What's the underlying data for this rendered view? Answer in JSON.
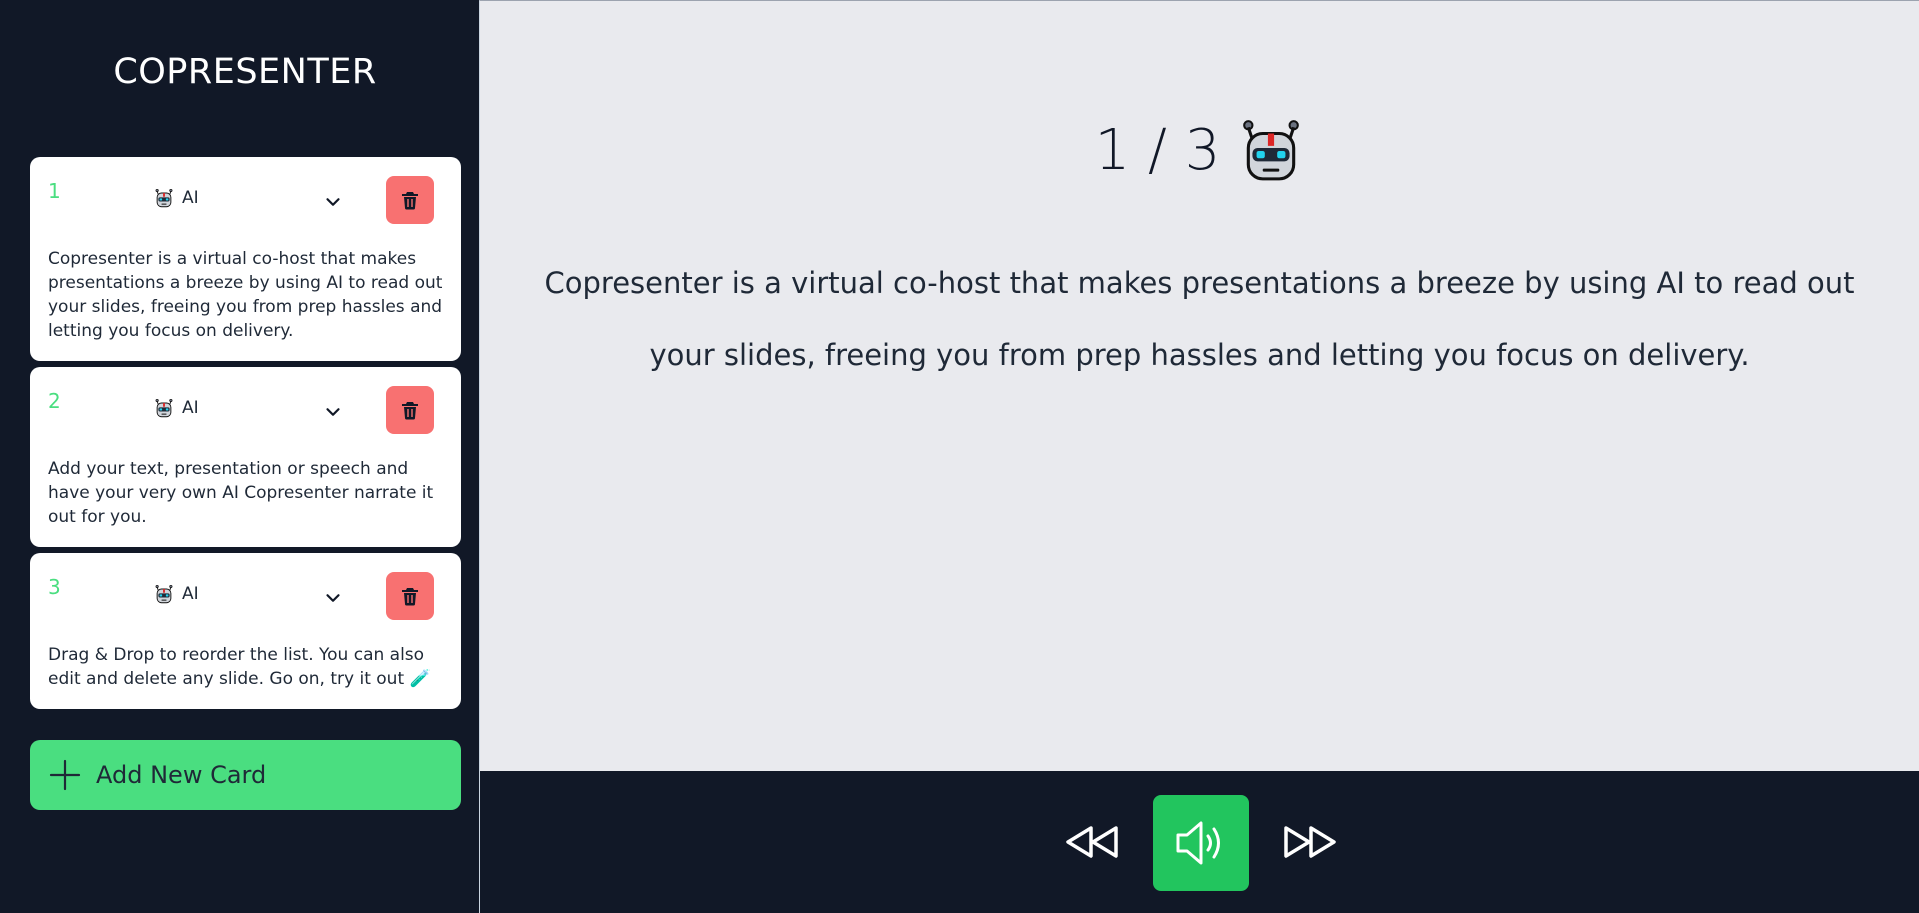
{
  "app": {
    "title": "COPRESENTER"
  },
  "cards": [
    {
      "number": "1",
      "voice": "AI",
      "text": "Copresenter is a virtual co-host that makes presentations a breeze by using AI to read out your slides, freeing you from prep hassles and letting you focus on delivery."
    },
    {
      "number": "2",
      "voice": "AI",
      "text": "Add your text, presentation or speech and have your very own AI Copresenter narrate it out for you."
    },
    {
      "number": "3",
      "voice": "AI",
      "text": "Drag & Drop to reorder the list. You can also edit and delete any slide. Go on, try it out 🧪"
    }
  ],
  "add_button": {
    "label": "Add New Card",
    "icon": "plus-icon"
  },
  "viewer": {
    "counter": "1 / 3",
    "text": "Copresenter is a virtual co-host that makes presentations a breeze by using AI to read out your slides, freeing you from prep hassles and letting you focus on delivery."
  },
  "player": {
    "rewind_icon": "rewind-icon",
    "speak_icon": "speaker-icon",
    "forward_icon": "fast-forward-icon"
  },
  "colors": {
    "sidebar": "#111827",
    "accent": "#4ade80",
    "speak": "#22c55e",
    "delete": "#f87171",
    "main_bg": "#e9eaee"
  }
}
